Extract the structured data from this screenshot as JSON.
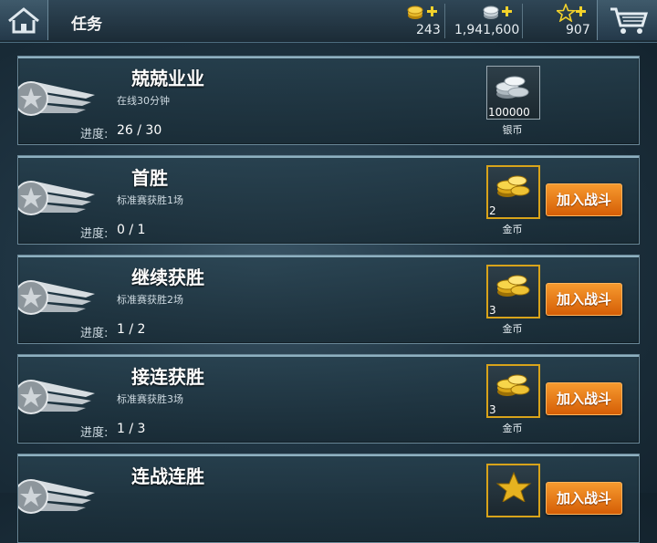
{
  "header": {
    "title": "任务",
    "currencies": [
      {
        "name": "gold",
        "value": "243"
      },
      {
        "name": "silver",
        "value": "1,941,600"
      },
      {
        "name": "stars",
        "value": "907"
      }
    ]
  },
  "tasks": [
    {
      "name": "兢兢业业",
      "desc": "在线30分钟",
      "progress_label": "进度:",
      "progress": "26 / 30",
      "reward_amount": "100000",
      "reward_label": "银币",
      "reward_type": "silver",
      "button": ""
    },
    {
      "name": "首胜",
      "desc": "标准赛获胜1场",
      "progress_label": "进度:",
      "progress": "0 / 1",
      "reward_amount": "2",
      "reward_label": "金币",
      "reward_type": "gold",
      "button": "加入战斗"
    },
    {
      "name": "继续获胜",
      "desc": "标准赛获胜2场",
      "progress_label": "进度:",
      "progress": "1 / 2",
      "reward_amount": "3",
      "reward_label": "金币",
      "reward_type": "gold",
      "button": "加入战斗"
    },
    {
      "name": "接连获胜",
      "desc": "标准赛获胜3场",
      "progress_label": "进度:",
      "progress": "1 / 3",
      "reward_amount": "3",
      "reward_label": "金币",
      "reward_type": "gold",
      "button": "加入战斗"
    },
    {
      "name": "连战连胜",
      "desc": "",
      "progress_label": "",
      "progress": "",
      "reward_amount": "",
      "reward_label": "",
      "reward_type": "star",
      "button": "加入战斗"
    }
  ],
  "colors": {
    "accent_button": "#e67a14",
    "gold_border": "#d8a31a"
  }
}
